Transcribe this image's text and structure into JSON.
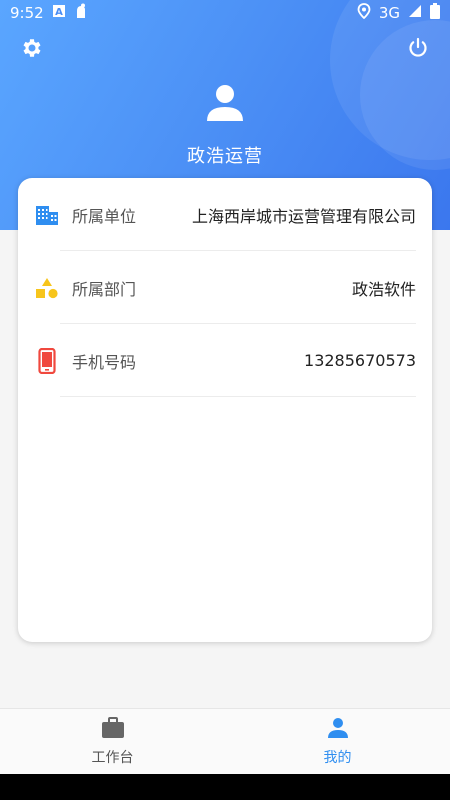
{
  "status_bar": {
    "time": "9:52",
    "network": "3G",
    "icons": [
      "notification-a-icon",
      "app-icon",
      "location-icon",
      "signal-icon",
      "battery-icon"
    ]
  },
  "header": {
    "company_name": "政浩运营",
    "icons": [
      "gear-icon",
      "power-icon",
      "user-avatar-icon"
    ]
  },
  "info": {
    "rows": [
      {
        "icon": "building-icon",
        "label": "所属单位",
        "value": "上海西岸城市运营管理有限公司"
      },
      {
        "icon": "shapes-icon",
        "label": "所属部门",
        "value": "政浩软件"
      },
      {
        "icon": "phone-icon",
        "label": "手机号码",
        "value": "13285670573"
      }
    ]
  },
  "tabbar": {
    "workbench_label": "工作台",
    "mine_label": "我的",
    "active": "我的"
  },
  "colors": {
    "accent": "#2f8ef0",
    "header_gradient_start": "#5aa6ff",
    "header_gradient_end": "#3b77ee",
    "building_icon": "#2f8ef0",
    "shapes_icon": "#f7c51c",
    "phone_icon": "#f0483e"
  }
}
